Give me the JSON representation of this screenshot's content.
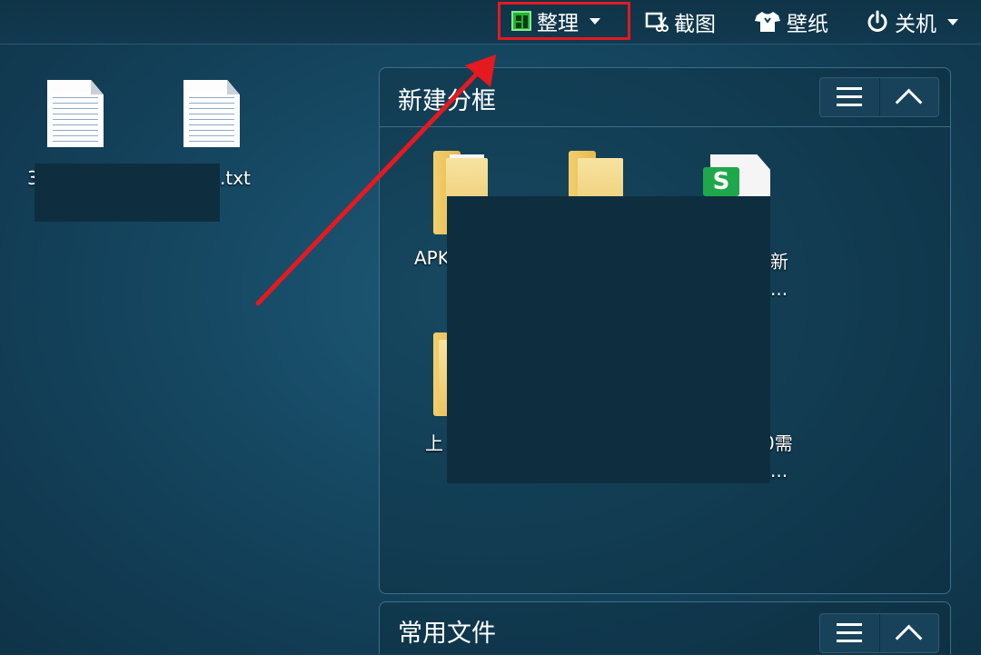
{
  "toolbar": {
    "organize_label": "整理",
    "screenshot_label": "截图",
    "wallpaper_label": "壁纸",
    "shutdown_label": "关机"
  },
  "desktop": {
    "files": [
      {
        "label": "3",
        "icon": "text-file-icon"
      },
      {
        "label": ".txt",
        "icon": "text-file-icon"
      }
    ]
  },
  "panels": [
    {
      "title": "新建分框",
      "items": [
        {
          "label": "APK",
          "icon": "folder-icon"
        },
        {
          "label": "",
          "icon": "folder-icon"
        },
        {
          "label": "新",
          "sublabel": "...",
          "icon": "spreadsheet-icon"
        },
        {
          "label": "上",
          "icon": "folder-icon"
        },
        {
          "label": "0需",
          "sublabel": "...",
          "icon": "file-icon"
        }
      ]
    },
    {
      "title": "常用文件",
      "items": []
    }
  ],
  "colors": {
    "highlight_red": "#e5191f",
    "accent_green": "#1fb72e",
    "sheet_green": "#1fa84b"
  },
  "icons": {
    "organize": "grid-layout-icon",
    "screenshot": "scissors-screenshot-icon",
    "wallpaper": "tshirt-icon",
    "shutdown": "power-icon",
    "panel_list": "list-icon",
    "panel_collapse": "chevron-up-icon"
  },
  "sheet_badge": "S"
}
